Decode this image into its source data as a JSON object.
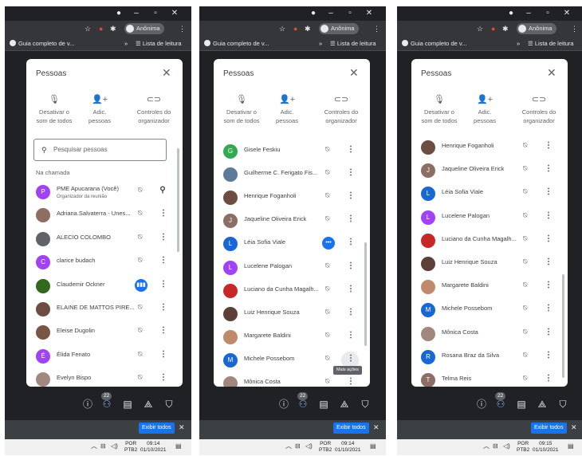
{
  "chrome": {
    "profile_label": "Anônima",
    "bookmark_label": "Guia completo de v...",
    "reading_list_label": "Lista de leitura",
    "bookmark_overflow": "»"
  },
  "panel": {
    "title": "Pessoas",
    "close_glyph": "✕",
    "actions": [
      {
        "icon": "mic-off-icon",
        "glyph": "🎙",
        "label_l1": "Desativar o",
        "label_l2": "som de todos"
      },
      {
        "icon": "add-person-icon",
        "glyph": "👤+",
        "label_l1": "Adic.",
        "label_l2": "pessoas"
      },
      {
        "icon": "toggle-icon",
        "glyph": "⊂⊃",
        "label_l1": "Controles do",
        "label_l2": "organizador"
      }
    ],
    "search_placeholder": "Pesquisar pessoas",
    "section_label": "Na chamada",
    "more_tooltip": "Mais ações"
  },
  "participants_1": [
    {
      "name": "PME Apucarana (Você)",
      "sub": "Organizador da reunião",
      "avatar": "P",
      "color": "#a142f4",
      "status": "pin"
    },
    {
      "name": "Adriana.Salvaterra - Unes...",
      "avatar": "",
      "color": "#8d6e63",
      "status": "muted"
    },
    {
      "name": "ALECIO COLOMBO",
      "avatar": "",
      "color": "#5f6368",
      "status": "muted"
    },
    {
      "name": "clarice budach",
      "avatar": "C",
      "color": "#a142f4",
      "status": "muted"
    },
    {
      "name": "Claudemir Ockner",
      "avatar": "",
      "color": "#33691e",
      "status": "speaking"
    },
    {
      "name": "ELAINE DE MATTOS PIRE...",
      "avatar": "",
      "color": "#6d4c41",
      "status": "muted"
    },
    {
      "name": "Eleise Dugolin",
      "avatar": "",
      "color": "#795548",
      "status": "muted"
    },
    {
      "name": "Élida Fenato",
      "avatar": "É",
      "color": "#a142f4",
      "status": "muted"
    },
    {
      "name": "Evelyn Bispo",
      "avatar": "",
      "color": "#a1887f",
      "status": "muted"
    }
  ],
  "participants_2": [
    {
      "name": "Gisele Feskiu",
      "avatar": "G",
      "color": "#34a853",
      "status": "muted"
    },
    {
      "name": "Guilherme C. Ferigato Fis...",
      "avatar": "",
      "color": "#5d7a99",
      "status": "muted"
    },
    {
      "name": "Henrique Foganholi",
      "avatar": "",
      "color": "#6d4c41",
      "status": "muted"
    },
    {
      "name": "Jaqueline Oliveira Erick",
      "avatar": "J",
      "color": "#8d6e63",
      "status": "muted"
    },
    {
      "name": "Léia Sofia Viale",
      "avatar": "L",
      "color": "#1967d2",
      "status": "dots"
    },
    {
      "name": "Lucelene Palogan",
      "avatar": "L",
      "color": "#a142f4",
      "status": "muted"
    },
    {
      "name": "Luciano da Cunha Magalh...",
      "avatar": "",
      "color": "#c62828",
      "status": "muted"
    },
    {
      "name": "Luiz Henrique Souza",
      "avatar": "",
      "color": "#5d4037",
      "status": "muted"
    },
    {
      "name": "Margarete Baldini",
      "avatar": "",
      "color": "#bf8a6b",
      "status": "muted"
    },
    {
      "name": "Michele Possebom",
      "avatar": "M",
      "color": "#1967d2",
      "status": "muted"
    },
    {
      "name": "Mônica Costa",
      "avatar": "",
      "color": "#a1887f",
      "status": "muted"
    }
  ],
  "participants_3": [
    {
      "name": "Henrique Foganholi",
      "avatar": "",
      "color": "#6d4c41",
      "status": "muted"
    },
    {
      "name": "Jaqueline Oliveira Erick",
      "avatar": "J",
      "color": "#8d6e63",
      "status": "muted"
    },
    {
      "name": "Léia Sofia Viale",
      "avatar": "L",
      "color": "#1967d2",
      "status": "muted"
    },
    {
      "name": "Lucelene Palogan",
      "avatar": "L",
      "color": "#a142f4",
      "status": "muted"
    },
    {
      "name": "Luciano da Cunha Magalh...",
      "avatar": "",
      "color": "#c62828",
      "status": "muted"
    },
    {
      "name": "Luiz Henrique Souza",
      "avatar": "",
      "color": "#5d4037",
      "status": "muted"
    },
    {
      "name": "Margarete Baldini",
      "avatar": "",
      "color": "#bf8a6b",
      "status": "muted"
    },
    {
      "name": "Michele Possebom",
      "avatar": "M",
      "color": "#1967d2",
      "status": "muted"
    },
    {
      "name": "Mônica Costa",
      "avatar": "",
      "color": "#a1887f",
      "status": "muted"
    },
    {
      "name": "Rosana Braz da Silva",
      "avatar": "R",
      "color": "#1967d2",
      "status": "muted"
    },
    {
      "name": "Telma Reis",
      "avatar": "T",
      "color": "#8d6e63",
      "status": "muted"
    }
  ],
  "meet_toolbar": {
    "people_count": "22"
  },
  "notification": {
    "show_all_label": "Exibir todos",
    "close_glyph": "✕"
  },
  "taskbar": [
    {
      "lang_l1": "POR",
      "lang_l2": "PTB2",
      "time": "09:14",
      "date": "01/10/2021"
    },
    {
      "lang_l1": "POR",
      "lang_l2": "PTB2",
      "time": "09:14",
      "date": "01/10/2021"
    },
    {
      "lang_l1": "POR",
      "lang_l2": "PTB2",
      "time": "09:15",
      "date": "01/10/2021"
    }
  ],
  "colors": {
    "accent": "#1a73e8",
    "dark_bg": "#202124",
    "panel_bg": "#ffffff"
  }
}
